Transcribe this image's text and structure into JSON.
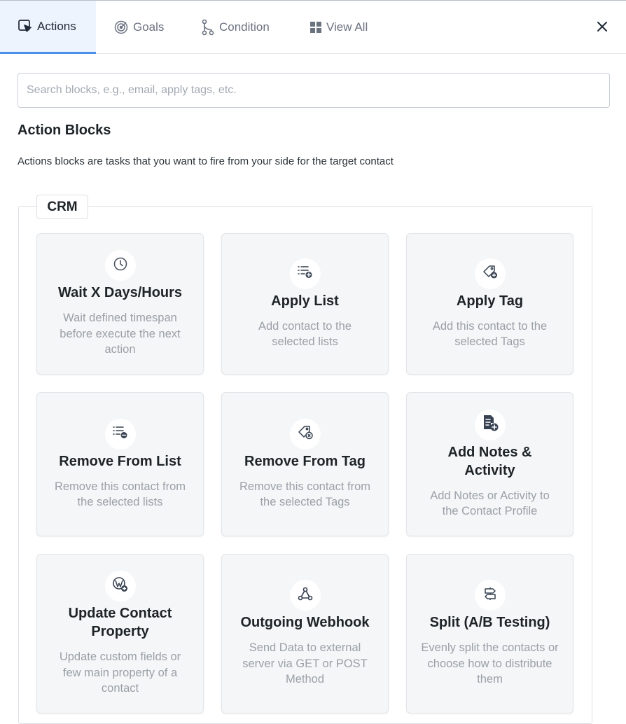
{
  "tabs": [
    {
      "label": "Actions",
      "icon": "cursor-click-icon"
    },
    {
      "label": "Goals",
      "icon": "target-icon"
    },
    {
      "label": "Condition",
      "icon": "branch-icon"
    },
    {
      "label": "View All",
      "icon": "grid-icon"
    }
  ],
  "search": {
    "placeholder": "Search blocks, e.g., email, apply tags, etc.",
    "value": ""
  },
  "section": {
    "title": "Action Blocks",
    "description": "Actions blocks are tasks that you want to fire from your side for the target contact"
  },
  "group": {
    "label": "CRM"
  },
  "blocks": [
    {
      "title": "Wait X Days/Hours",
      "description": "Wait defined timespan before execute the next action",
      "icon": "clock-icon"
    },
    {
      "title": "Apply List",
      "description": "Add contact to the selected lists",
      "icon": "list-add-icon"
    },
    {
      "title": "Apply Tag",
      "description": "Add this contact to the selected Tags",
      "icon": "tag-add-icon"
    },
    {
      "title": "Remove From List",
      "description": "Remove this contact from the selected lists",
      "icon": "list-remove-icon"
    },
    {
      "title": "Remove From Tag",
      "description": "Remove this contact from the selected Tags",
      "icon": "tag-remove-icon"
    },
    {
      "title": "Add Notes & Activity",
      "description": "Add Notes or Activity to the Contact Profile",
      "icon": "note-add-icon"
    },
    {
      "title": "Update Contact Property",
      "description": "Update custom fields or few main property of a contact",
      "icon": "wordpress-icon"
    },
    {
      "title": "Outgoing Webhook",
      "description": "Send Data to external server via GET or POST Method",
      "icon": "webhook-icon"
    },
    {
      "title": "Split (A/B Testing)",
      "description": "Evenly split the contacts or choose how to distribute them",
      "icon": "split-icon"
    }
  ],
  "colors": {
    "accent": "#4b8fe8",
    "active_tab_bg": "#eef4fd",
    "card_bg": "#f5f6f7"
  }
}
